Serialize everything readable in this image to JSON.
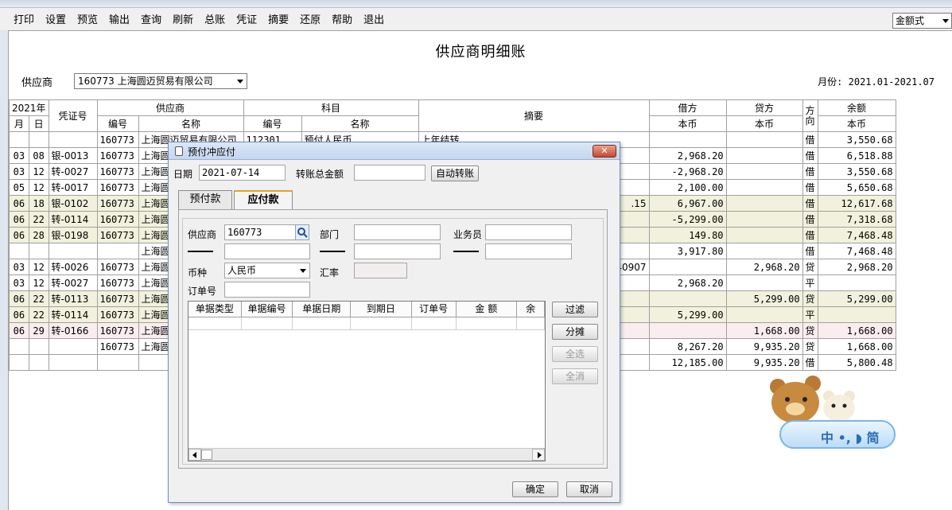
{
  "toolbar": {
    "buttons": [
      "打印",
      "设置",
      "预览",
      "输出",
      "查询",
      "刷新",
      "总账",
      "凭证",
      "摘要",
      "还原",
      "帮助",
      "退出"
    ],
    "mode_value": "金额式"
  },
  "report": {
    "title": "供应商明细账",
    "supplier_label": "供应商",
    "supplier_value": "160773  上海圆迈贸易有限公司",
    "month_label": "月份: 2021.01-2021.07"
  },
  "grid": {
    "header": {
      "year": "2021年",
      "month": "月",
      "day": "日",
      "voucher": "凭证号",
      "supplier": "供应商",
      "subject": "科目",
      "code": "编号",
      "name": "名称",
      "summary": "摘要",
      "debit": "借方",
      "credit": "贷方",
      "direction": "方向",
      "balance": "余额",
      "currency": "本币"
    },
    "rows": [
      {
        "m": "",
        "d": "",
        "v": "",
        "sc": "160773",
        "sn": "上海圆迈贸易有限公司",
        "kc": "112301",
        "kn": "预付人民币",
        "sum": "上年结转",
        "dr": "",
        "cr": "",
        "dir": "借",
        "bal": "3,550.68",
        "hl": ""
      },
      {
        "m": "03",
        "d": "08",
        "v": "银-0013",
        "sc": "160773",
        "sn": "上海圆",
        "kc": "",
        "kn": "",
        "sum": "",
        "dr": "2,968.20",
        "cr": "",
        "dir": "借",
        "bal": "6,518.88",
        "hl": ""
      },
      {
        "m": "03",
        "d": "12",
        "v": "转-0027",
        "sc": "160773",
        "sn": "上海圆",
        "kc": "",
        "kn": "",
        "sum": "",
        "dr": "-2,968.20",
        "cr": "",
        "dir": "借",
        "bal": "3,550.68",
        "hl": ""
      },
      {
        "m": "05",
        "d": "12",
        "v": "转-0017",
        "sc": "160773",
        "sn": "上海圆",
        "kc": "",
        "kn": "",
        "sum": "",
        "dr": "2,100.00",
        "cr": "",
        "dir": "借",
        "bal": "5,650.68",
        "hl": ""
      },
      {
        "m": "06",
        "d": "18",
        "v": "银-0102",
        "sc": "160773",
        "sn": "上海圆",
        "kc": "",
        "kn": "",
        "sum": ".15",
        "dr": "6,967.00",
        "cr": "",
        "dir": "借",
        "bal": "12,617.68",
        "hl": "hl"
      },
      {
        "m": "06",
        "d": "22",
        "v": "转-0114",
        "sc": "160773",
        "sn": "上海圆",
        "kc": "",
        "kn": "",
        "sum": "",
        "dr": "-5,299.00",
        "cr": "",
        "dir": "借",
        "bal": "7,318.68",
        "hl": "hl"
      },
      {
        "m": "06",
        "d": "28",
        "v": "银-0198",
        "sc": "160773",
        "sn": "上海圆",
        "kc": "",
        "kn": "",
        "sum": "",
        "dr": "149.80",
        "cr": "",
        "dir": "借",
        "bal": "7,468.48",
        "hl": "hl"
      },
      {
        "m": "",
        "d": "",
        "v": "",
        "sc": "",
        "sn": "上海圆",
        "kc": "",
        "kn": "",
        "sum": "",
        "dr": "3,917.80",
        "cr": "",
        "dir": "借",
        "bal": "7,468.48",
        "hl": ""
      },
      {
        "m": "03",
        "d": "12",
        "v": "转-0026",
        "sc": "160773",
        "sn": "上海圆",
        "kc": "",
        "kn": "",
        "sum": "40907",
        "dr": "",
        "cr": "2,968.20",
        "dir": "贷",
        "bal": "2,968.20",
        "hl": ""
      },
      {
        "m": "03",
        "d": "12",
        "v": "转-0027",
        "sc": "160773",
        "sn": "上海圆",
        "kc": "",
        "kn": "",
        "sum": "",
        "dr": "2,968.20",
        "cr": "",
        "dir": "平",
        "bal": "",
        "hl": ""
      },
      {
        "m": "06",
        "d": "22",
        "v": "转-0113",
        "sc": "160773",
        "sn": "上海圆",
        "kc": "",
        "kn": "",
        "sum": "",
        "dr": "",
        "cr": "5,299.00",
        "dir": "贷",
        "bal": "5,299.00",
        "hl": "hl"
      },
      {
        "m": "06",
        "d": "22",
        "v": "转-0114",
        "sc": "160773",
        "sn": "上海圆",
        "kc": "",
        "kn": "",
        "sum": "",
        "dr": "5,299.00",
        "cr": "",
        "dir": "平",
        "bal": "",
        "hl": "hl"
      },
      {
        "m": "06",
        "d": "29",
        "v": "转-0166",
        "sc": "160773",
        "sn": "上海圆",
        "kc": "",
        "kn": "",
        "sum": "",
        "dr": "",
        "cr": "1,668.00",
        "dir": "贷",
        "bal": "1,668.00",
        "hl": "pk"
      },
      {
        "m": "",
        "d": "",
        "v": "",
        "sc": "160773",
        "sn": "上海圆",
        "kc": "",
        "kn": "",
        "sum": "",
        "dr": "8,267.20",
        "cr": "9,935.20",
        "dir": "贷",
        "bal": "1,668.00",
        "hl": ""
      },
      {
        "m": "",
        "d": "",
        "v": "",
        "sc": "",
        "sn": "",
        "kc": "",
        "kn": "",
        "sum": "",
        "dr": "12,185.00",
        "cr": "9,935.20",
        "dir": "借",
        "bal": "5,800.48",
        "hl": ""
      }
    ]
  },
  "dialog": {
    "title": "预付冲应付",
    "close_label": "✕",
    "date_label": "日期",
    "date_value": "2021-07-14",
    "total_label": "转账总金额",
    "total_value": "",
    "auto_button": "自动转账",
    "tabs": [
      "预付款",
      "应付款"
    ],
    "supplier_label": "供应商",
    "supplier_value": "160773",
    "dept_label": "部门",
    "salesman_label": "业务员",
    "currency_label": "币种",
    "currency_value": "人民币",
    "rate_label": "汇率",
    "order_label": "订单号",
    "columns": [
      "单据类型",
      "单据编号",
      "单据日期",
      "到期日",
      "订单号",
      "金    额",
      "余"
    ],
    "side_buttons": [
      "过滤",
      "分摊",
      "全选",
      "全消"
    ],
    "ok_button": "确定",
    "cancel_button": "取消"
  },
  "ime": {
    "label": "中 •, ◗ 简"
  }
}
